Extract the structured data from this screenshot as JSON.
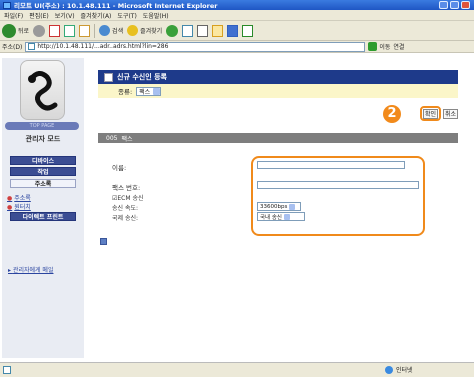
{
  "window": {
    "title": "리모트 UI(주소) : 10.1.48.111 - Microsoft Internet Explorer"
  },
  "menu": [
    "파일(F)",
    "편집(E)",
    "보기(V)",
    "즐겨찾기(A)",
    "도구(T)",
    "도움말(H)"
  ],
  "toolbar": {
    "back": "뒤로",
    "search": "검색",
    "favorites": "즐겨찾기"
  },
  "address": {
    "label": "주소(D)",
    "url": "http://10.1.48.111/...adr..adrs.html?lin=286",
    "go": "이동",
    "links": "연결"
  },
  "sidebar": {
    "logo_label": "TOP PAGE",
    "admin_mode": "관리자 모드",
    "nav": [
      "디바이스",
      "작업",
      "주소록"
    ],
    "sub_items": [
      "주소록",
      "원터치"
    ],
    "last_nav": "다이렉트 프린트",
    "mail_link": "관리자에게 메일"
  },
  "dialog": {
    "title": "신규 수신인 등록",
    "type_label": "종류:",
    "type_value": "팩스",
    "step_number": "2",
    "confirm_button": "확인",
    "cancel_button": "취소",
    "section_number": "005",
    "section_label": "팩스",
    "fields": {
      "name_label": "이름:",
      "fax_label": "팩스 번호:",
      "ecm_label": "☑ECM 송신",
      "speed_label": "송신 속도:",
      "speed_value": "33600bps",
      "intl_label": "국제 송신:",
      "intl_value": "국내 송신"
    }
  },
  "status": {
    "zone": "인터넷"
  }
}
